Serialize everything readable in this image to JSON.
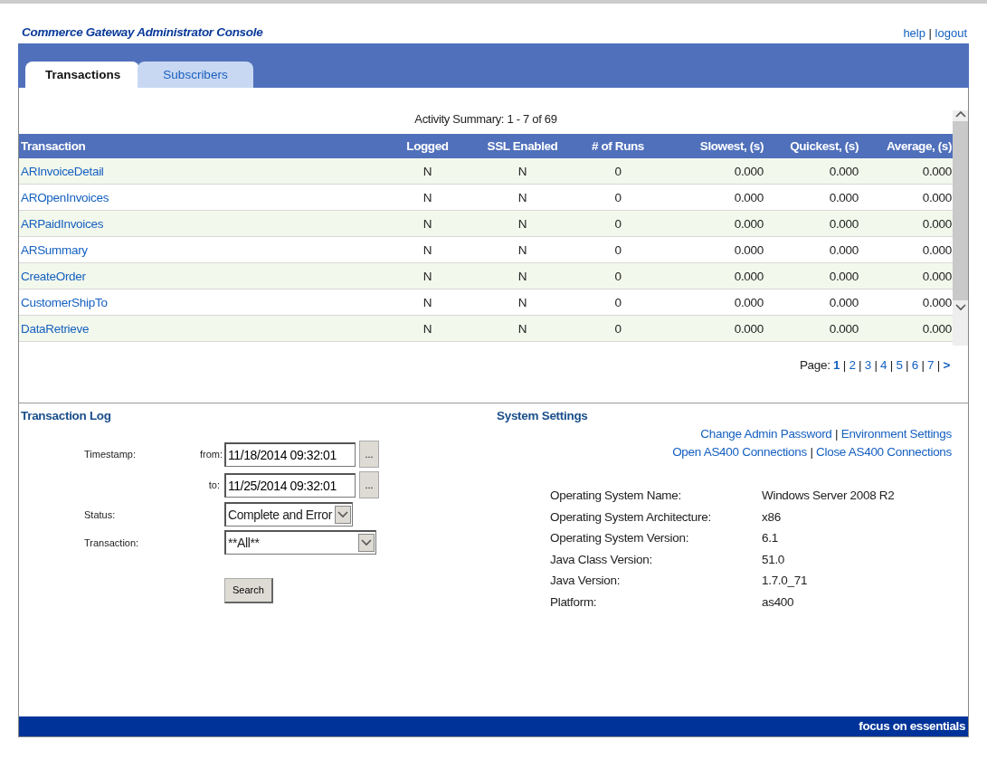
{
  "header": {
    "title": "Commerce Gateway Administrator Console",
    "links": [
      "help",
      "logout"
    ],
    "separator": "|"
  },
  "tabs": [
    {
      "label": "Transactions",
      "selected": true
    },
    {
      "label": "Subscribers",
      "selected": false
    }
  ],
  "activity": {
    "summary": "Activity Summary:  1 - 7 of 69",
    "columns": [
      "Transaction",
      "Logged",
      "SSL Enabled",
      "# of Runs",
      "Slowest, (s)",
      "Quickest, (s)",
      "Average, (s)"
    ],
    "rows": [
      {
        "cells": [
          "ARInvoiceDetail",
          "N",
          "N",
          "0",
          "0.000",
          "0.000",
          "0.000"
        ]
      },
      {
        "cells": [
          "AROpenInvoices",
          "N",
          "N",
          "0",
          "0.000",
          "0.000",
          "0.000"
        ]
      },
      {
        "cells": [
          "ARPaidInvoices",
          "N",
          "N",
          "0",
          "0.000",
          "0.000",
          "0.000"
        ]
      },
      {
        "cells": [
          "ARSummary",
          "N",
          "N",
          "0",
          "0.000",
          "0.000",
          "0.000"
        ]
      },
      {
        "cells": [
          "CreateOrder",
          "N",
          "N",
          "0",
          "0.000",
          "0.000",
          "0.000"
        ]
      },
      {
        "cells": [
          "CustomerShipTo",
          "N",
          "N",
          "0",
          "0.000",
          "0.000",
          "0.000"
        ]
      },
      {
        "cells": [
          "DataRetrieve",
          "N",
          "N",
          "0",
          "0.000",
          "0.000",
          "0.000"
        ]
      }
    ]
  },
  "pagination": {
    "label": "Page:",
    "separator": "|",
    "pages": [
      {
        "label": "1",
        "selected": true
      },
      {
        "label": "2",
        "selected": false
      },
      {
        "label": "3",
        "selected": false
      },
      {
        "label": "4",
        "selected": false
      },
      {
        "label": "5",
        "selected": false
      },
      {
        "label": "6",
        "selected": false
      },
      {
        "label": "7",
        "selected": false
      }
    ],
    "next": ">"
  },
  "transaction_log": {
    "title": "Transaction Log",
    "timestamp_label": "Timestamp:",
    "from": {
      "label": "from:",
      "value": "11/18/2014 09:32:01",
      "button": "..."
    },
    "to": {
      "label": "to:",
      "value": "11/25/2014 09:32:01",
      "button": "..."
    },
    "status": {
      "label": "Status:",
      "value": "Complete and Error"
    },
    "transaction": {
      "label": "Transaction:",
      "value": "**All**"
    },
    "search_button": "Search"
  },
  "system_settings": {
    "title": "System Settings",
    "separator": "|",
    "link_rows": [
      [
        "Change Admin Password",
        "Environment Settings"
      ],
      [
        "Open AS400 Connections",
        "Close AS400 Connections"
      ]
    ],
    "info": [
      {
        "label": "Operating System Name:",
        "value": "Windows Server 2008 R2"
      },
      {
        "label": "Operating System Architecture:",
        "value": "x86"
      },
      {
        "label": "Operating System Version:",
        "value": "6.1"
      },
      {
        "label": "Java Class Version:",
        "value": "51.0"
      },
      {
        "label": "Java Version:",
        "value": "1.7.0_71"
      },
      {
        "label": "Platform:",
        "value": "as400"
      }
    ]
  },
  "footer": {
    "text": "focus on essentials"
  }
}
